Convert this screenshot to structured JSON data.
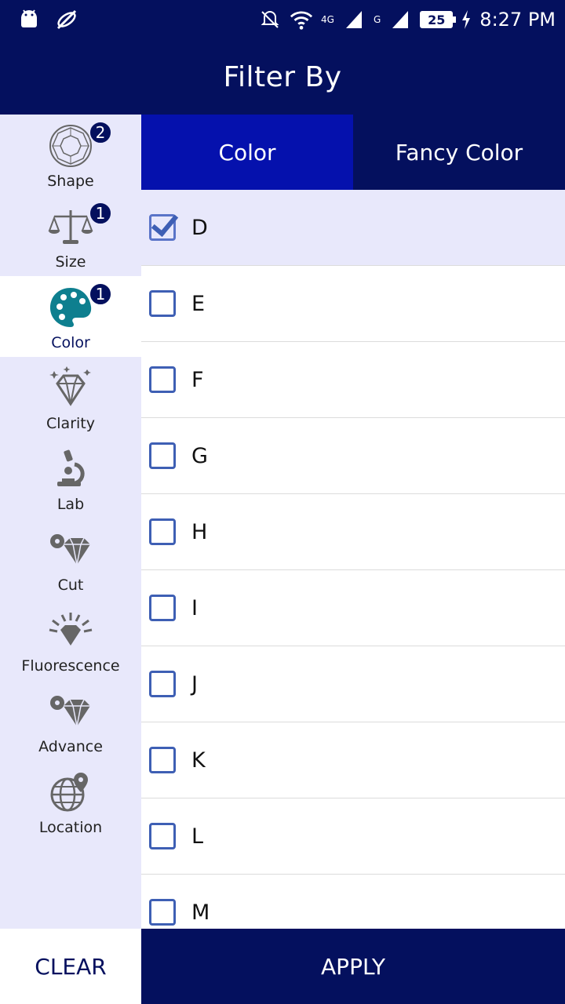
{
  "status_bar": {
    "time": "8:27 PM",
    "battery": "25",
    "network_1": "4G",
    "network_2": "G"
  },
  "header": {
    "title": "Filter By"
  },
  "sidebar": {
    "items": [
      {
        "label": "Shape",
        "badge": "2",
        "icon": "shape-icon"
      },
      {
        "label": "Size",
        "badge": "1",
        "icon": "scale-icon"
      },
      {
        "label": "Color",
        "badge": "1",
        "icon": "palette-icon",
        "active": true
      },
      {
        "label": "Clarity",
        "icon": "diamond-icon"
      },
      {
        "label": "Lab",
        "icon": "microscope-icon"
      },
      {
        "label": "Cut",
        "icon": "cut-icon"
      },
      {
        "label": "Fluorescence",
        "icon": "fluorescence-icon"
      },
      {
        "label": "Advance",
        "icon": "advance-icon"
      },
      {
        "label": "Location",
        "icon": "location-icon"
      }
    ]
  },
  "tabs": [
    {
      "label": "Color",
      "active": true
    },
    {
      "label": "Fancy Color",
      "active": false
    }
  ],
  "options": [
    {
      "label": "D",
      "checked": true
    },
    {
      "label": "E",
      "checked": false
    },
    {
      "label": "F",
      "checked": false
    },
    {
      "label": "G",
      "checked": false
    },
    {
      "label": "H",
      "checked": false
    },
    {
      "label": "I",
      "checked": false
    },
    {
      "label": "J",
      "checked": false
    },
    {
      "label": "K",
      "checked": false
    },
    {
      "label": "L",
      "checked": false
    },
    {
      "label": "M",
      "checked": false
    }
  ],
  "footer": {
    "clear_label": "CLEAR",
    "apply_label": "APPLY"
  },
  "colors": {
    "primary": "#04105e",
    "tab_active": "#0511ad",
    "sidebar_bg": "#e8e8fb",
    "checkbox": "#3e5fb4",
    "palette_teal": "#0e7f8f"
  }
}
